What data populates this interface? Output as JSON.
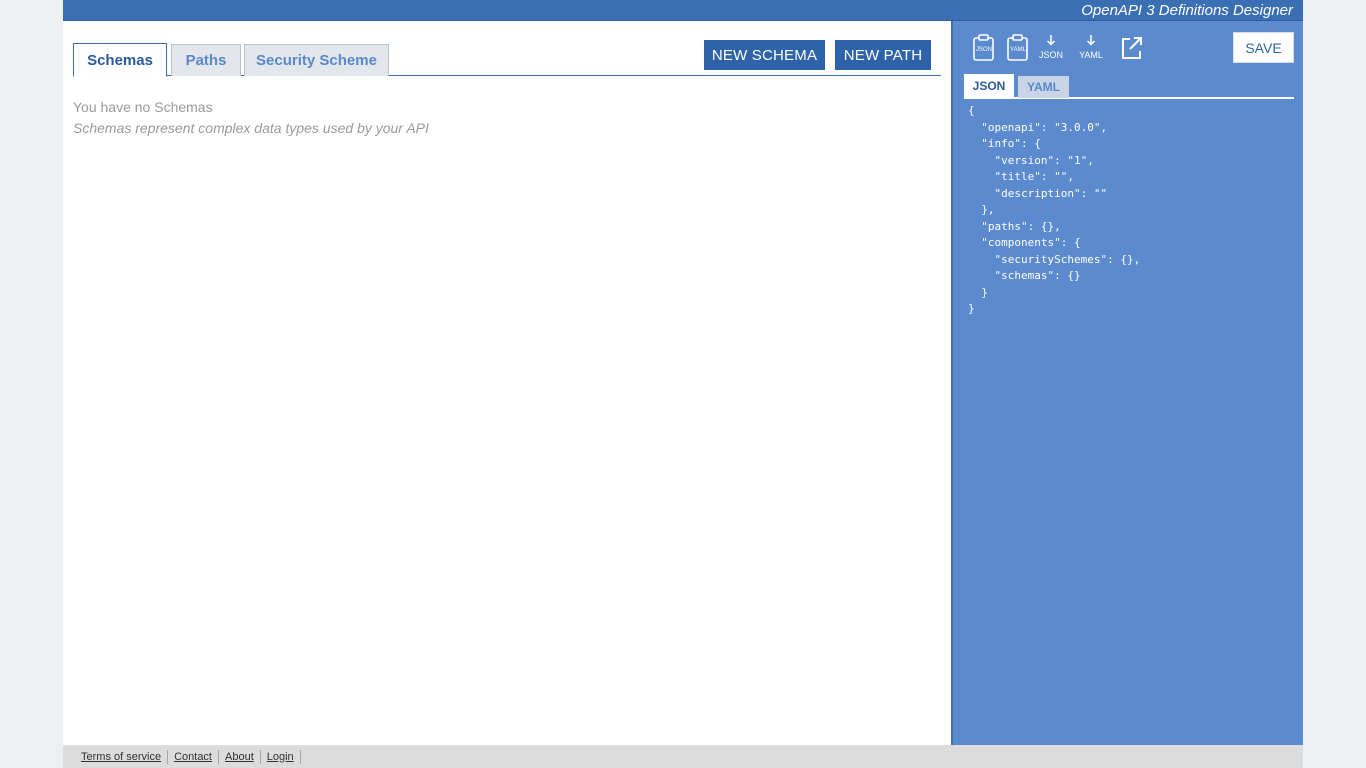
{
  "app": {
    "title": "OpenAPI 3 Definitions Designer"
  },
  "left": {
    "tabs": [
      {
        "label": "Schemas",
        "active": true
      },
      {
        "label": "Paths",
        "active": false
      },
      {
        "label": "Security Scheme",
        "active": false
      }
    ],
    "buttons": {
      "new_schema": "NEW SCHEMA",
      "new_path": "NEW PATH"
    },
    "empty_state": {
      "title": "You have no Schemas",
      "description": "Schemas represent complex data types used by your API"
    }
  },
  "right": {
    "toolbar": {
      "copy_json_label": "JSON",
      "copy_yaml_label": "YAML",
      "download_json_label": "JSON",
      "download_yaml_label": "YAML",
      "icons": [
        "clipboard-json-icon",
        "clipboard-yaml-icon",
        "download-json-icon",
        "download-yaml-icon",
        "open-external-icon"
      ],
      "save_label": "SAVE"
    },
    "code_tabs": [
      {
        "label": "JSON",
        "active": true
      },
      {
        "label": "YAML",
        "active": false
      }
    ],
    "code": "{\n  \"openapi\": \"3.0.0\",\n  \"info\": {\n    \"version\": \"1\",\n    \"title\": \"\",\n    \"description\": \"\"\n  },\n  \"paths\": {},\n  \"components\": {\n    \"securitySchemes\": {},\n    \"schemas\": {}\n  }\n}"
  },
  "footer": {
    "links": [
      "Terms of service",
      "Contact",
      "About",
      "Login"
    ]
  },
  "colors": {
    "brand": "#3b6fb4",
    "button": "#2f63a9",
    "right_panel": "#5b8ace"
  }
}
